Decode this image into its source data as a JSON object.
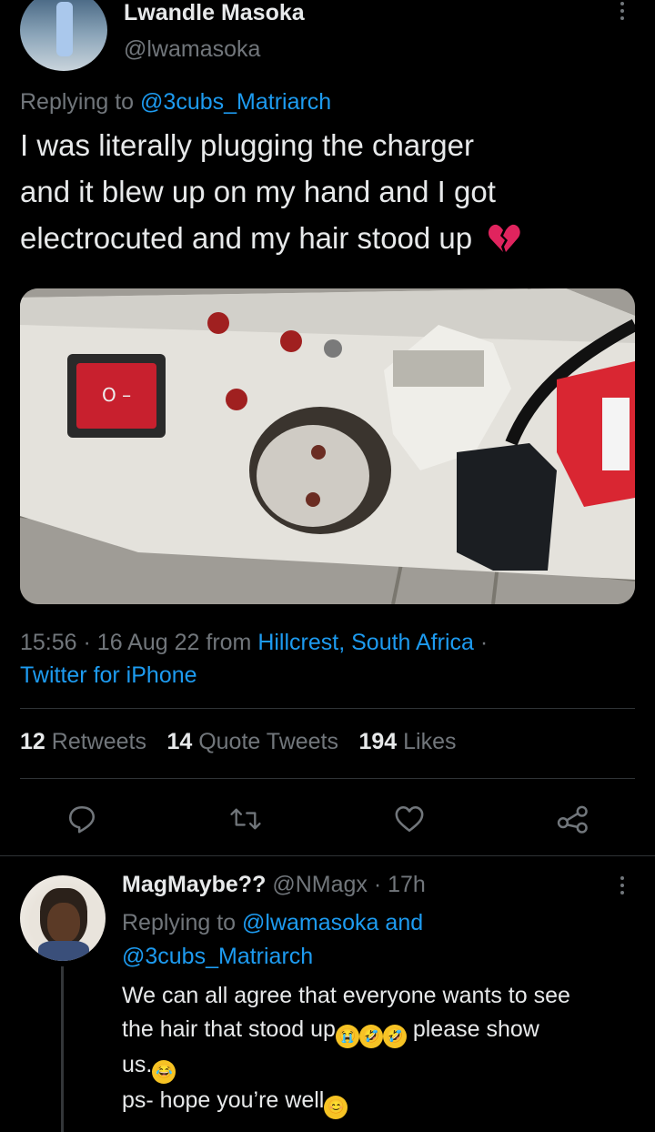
{
  "tweet": {
    "author_name": "Lwandle Masoka",
    "author_handle": "@lwamasoka",
    "replying_prefix": "Replying to",
    "replying_to": "@3cubs_Matriarch",
    "text_line1": "I was literally plugging the charger",
    "text_line2": "and it blew up on my hand and I got",
    "text_line3": "electrocuted and my hair stood up",
    "text_emoji": "broken-heart-emoji",
    "time": "15:56",
    "date": "16 Aug 22",
    "from_label": "from",
    "location": "Hillcrest, South Africa",
    "separator": "·",
    "client": "Twitter for iPhone",
    "stats": {
      "retweets_count": "12",
      "retweets_label": "Retweets",
      "quotes_count": "14",
      "quotes_label": "Quote Tweets",
      "likes_count": "194",
      "likes_label": "Likes"
    }
  },
  "reply": {
    "author_name": "MagMaybe??",
    "author_handle": "@NMagx",
    "age": "· 17h",
    "replying_prefix": "Replying to",
    "replying_to_1": "@lwamasoka",
    "replying_and": "and",
    "replying_to_2": "@3cubs_Matriarch",
    "line1": "We can all agree that everyone wants to see",
    "line2_a": "the hair that stood up",
    "line2_b": " please show",
    "line3": "us.",
    "line4": "ps- hope you’re well"
  },
  "colors": {
    "background": "#000000",
    "text": "#e7e9ea",
    "muted": "#71767b",
    "accent": "#1d9bf0",
    "divider": "#2f3336"
  },
  "icons": [
    "reply-icon",
    "retweet-icon",
    "like-icon",
    "share-icon",
    "more-icon"
  ]
}
